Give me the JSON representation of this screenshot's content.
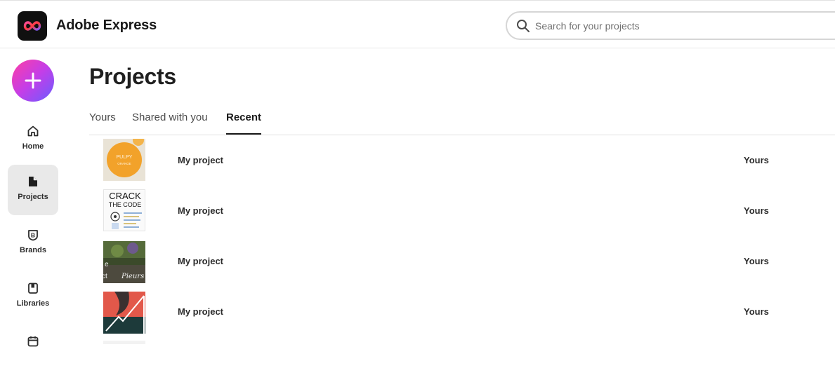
{
  "header": {
    "app_name": "Adobe Express",
    "search_placeholder": "Search for your projects"
  },
  "sidebar": {
    "create_icon": "plus-icon",
    "items": [
      {
        "label": "Home",
        "icon": "home-icon",
        "active": false
      },
      {
        "label": "Projects",
        "icon": "projects-icon",
        "active": true
      },
      {
        "label": "Brands",
        "icon": "brands-icon",
        "active": false
      },
      {
        "label": "Libraries",
        "icon": "libraries-icon",
        "active": false
      },
      {
        "label": "",
        "icon": "calendar-icon",
        "active": false
      }
    ]
  },
  "main": {
    "title": "Projects",
    "tabs": [
      {
        "label": "Yours",
        "active": false
      },
      {
        "label": "Shared with you",
        "active": false
      },
      {
        "label": "Recent",
        "active": true
      }
    ],
    "rows": [
      {
        "name": "My project",
        "owner": "Yours",
        "thumb_text": [
          "PULPY",
          "ORANGE"
        ]
      },
      {
        "name": "My project",
        "owner": "Yours",
        "thumb_text": [
          "CRACK",
          "THE CODE"
        ]
      },
      {
        "name": "My project",
        "owner": "Yours",
        "thumb_text": [
          "e",
          "ct",
          "Pieurs"
        ]
      },
      {
        "name": "My project",
        "owner": "Yours",
        "thumb_text": []
      }
    ]
  },
  "colors": {
    "accent_gradient": [
      "#ff3ea5",
      "#c33ee8",
      "#6a5cff"
    ],
    "active_nav_bg": "#e9e9e9",
    "logo_bg": "#101010"
  }
}
